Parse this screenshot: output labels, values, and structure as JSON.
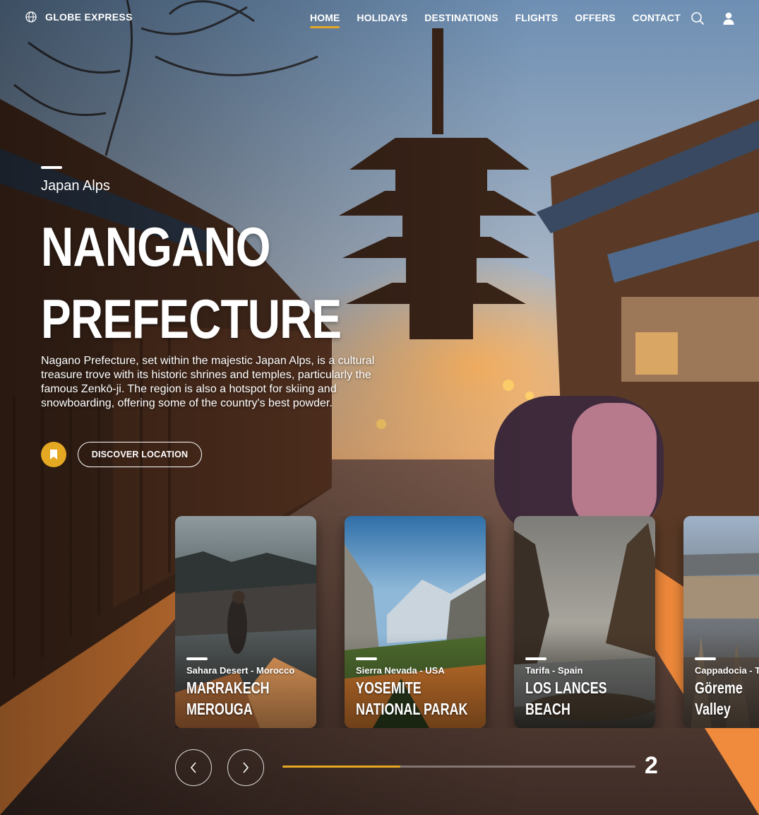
{
  "brand": {
    "name": "GLOBE EXPRESS",
    "icon": "globe-icon"
  },
  "nav": {
    "items": [
      {
        "label": "HOME",
        "active": true
      },
      {
        "label": "HOLIDAYS",
        "active": false
      },
      {
        "label": "DESTINATIONS",
        "active": false
      },
      {
        "label": "FLIGHTS",
        "active": false
      },
      {
        "label": "OFFERS",
        "active": false
      },
      {
        "label": "CONTACT",
        "active": false
      }
    ],
    "icons": [
      "search-icon",
      "user-icon"
    ]
  },
  "hero": {
    "region": "Japan Alps",
    "title_line1": "NANGANO",
    "title_line2": "PREFECTURE",
    "description": "Nagano Prefecture, set within the majestic Japan Alps, is a cultural treasure trove with its historic shrines and temples, particularly the famous Zenkō-ji. The region is also a hotspot for skiing and snowboarding, offering some of the country's best powder.",
    "bookmark_icon": "bookmark-icon",
    "discover_label": "DISCOVER LOCATION"
  },
  "cards": [
    {
      "subtitle": "Sahara Desert - Morocco",
      "title_line1": "MARRAKECH",
      "title_line2": "MEROUGA"
    },
    {
      "subtitle": "Sierra Nevada - USA",
      "title_line1": "YOSEMITE",
      "title_line2": "NATIONAL PARAK"
    },
    {
      "subtitle": "Tarifa - Spain",
      "title_line1": "LOS LANCES",
      "title_line2": "BEACH"
    },
    {
      "subtitle": "Cappadocia - Turkey",
      "title_line1": "Göreme",
      "title_line2": "Valley"
    }
  ],
  "slider": {
    "current": "2",
    "progress": 0.334,
    "prev_icon": "chevron-left-icon",
    "next_icon": "chevron-right-icon"
  },
  "colors": {
    "accent": "#e5a823",
    "text": "#ffffff"
  }
}
